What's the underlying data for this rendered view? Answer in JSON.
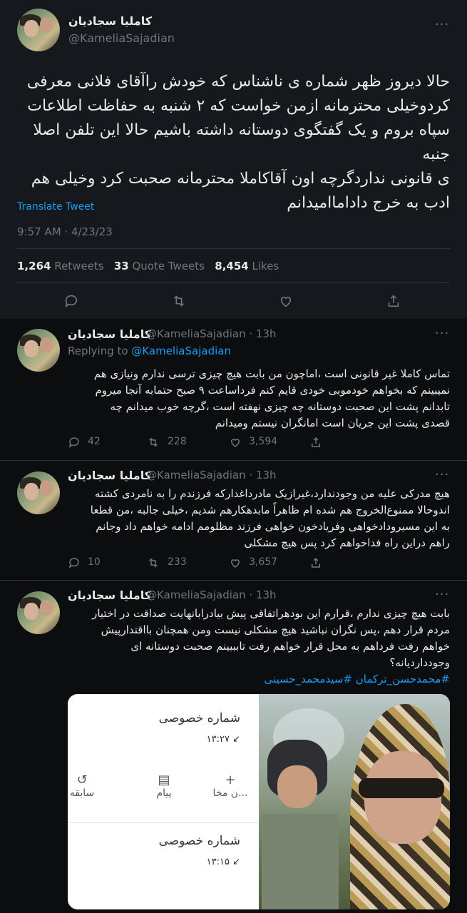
{
  "main_tweet": {
    "author_name": "کاملیا سجادیان",
    "author_handle": "@KameliaSajadian",
    "lines": [
      "حالا دیروز ظهر شماره ی ناشناس که خودش راآقای فلانی معرفی",
      "کردوخیلی محترمانه ازمن خواست که ۲ شنبه به حفاظت اطلاعات",
      "سپاه بروم و یک گفتگوی دوستانه داشته باشیم حالا این تلفن اصلا جنبه",
      "ی قانونی ندارد‌گرچه اون آقاکاملا محترمانه صحبت کرد وخیلی هم",
      "ادب به خرج داداماامیدانم"
    ],
    "translate_label": "Translate Tweet",
    "timestamp": "9:57 AM · 4/23/23",
    "stats": {
      "retweets_count": "1,264",
      "retweets_label": "Retweets",
      "quotes_count": "33",
      "quotes_label": "Quote Tweets",
      "likes_count": "8,454",
      "likes_label": "Likes"
    },
    "more_icon": "ellipsis-icon",
    "actions": [
      "reply-icon",
      "retweet-icon",
      "like-icon",
      "share-icon"
    ]
  },
  "replies": [
    {
      "author_name": "کاملیا سجادیان",
      "author_handle": "@KameliaSajadian",
      "time": "· 13h",
      "replying_label": "Replying to",
      "replying_handle": "@KameliaSajadian",
      "lines": [
        "تماس کاملا غیر قانونی است ،اماچون من بابت هیچ چیزی ترسی ندارم ونیازی هم",
        "نمیبینم که بخواهم خودموبی خودی قایم کنم فرداساعت ۹ صبح حتمابه آنجا میروم",
        "تابدانم پشت این صحبت دوستانه چه چیزی نهفته است ،گرچه خوب میدانم چه",
        "قصدی پشت این جریان است امانگران نیستم ومیدانم"
      ],
      "reply_count": "42",
      "retweet_count": "228",
      "like_count": "3,594"
    },
    {
      "author_name": "کاملیا سجادیان",
      "author_handle": "@KameliaSajadian",
      "time": "· 13h",
      "lines": [
        "هیچ مدرکی علیه من وجودندارد،غیرازیک مادرداغدارکه فرزندم را به نامردی کشته",
        "اندوحالا ممنوع‌الخروج هم شده ام ظاهراً مابدهکارهم شدیم ،خیلی جالبه ،من قطعا",
        "به این مسیرودادخواهی وفریادخون خواهی فرزند مظلومم ادامه خواهم داد وجانم",
        "راهم دراین راه فداخواهم کرد پس هیچ مشکلی"
      ],
      "reply_count": "10",
      "retweet_count": "233",
      "like_count": "3,657"
    },
    {
      "author_name": "کاملیا سجادیان",
      "author_handle": "@KameliaSajadian",
      "time": "· 13h",
      "lines": [
        "بابت هیچ چیزی ندارم ،قرارم این بودهراتفاقی پیش بیادرابانهایت صداقت در اختیار",
        "مردم قرار دهم ،پس نگران نباشید هیچ مشکلی نیست ومن همچنان بااقتدارپیش",
        "خواهم رفت فرداهم به محل قرار خواهم رفت تابببینم صحبت دوستانه ای",
        "وجوددارد‌یانه؟"
      ],
      "hashtags": "#محمدحسن_ترکمان #سیدمحمد_حسینی",
      "phone_card": {
        "title_top": "شماره خصوصی",
        "time_top": "۱۳:۲۷ ↙",
        "action_1": "سابقه",
        "action_2": "پیام",
        "action_3": "ن مخا...",
        "title_bottom": "شماره خصوصی",
        "time_bottom": "۱۳:۱۵ ↙"
      }
    }
  ]
}
